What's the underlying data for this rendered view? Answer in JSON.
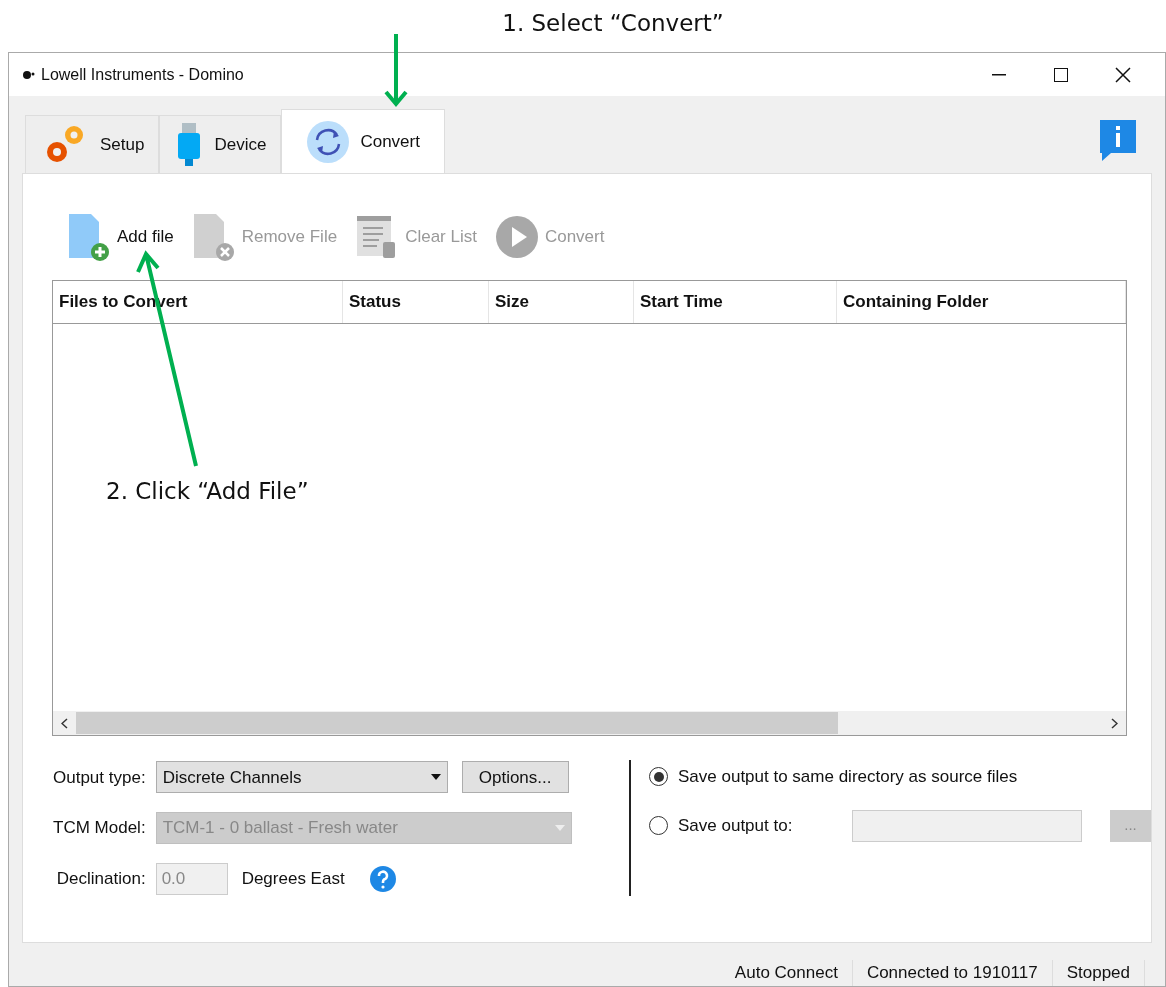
{
  "annotations": [
    {
      "text": "1. Select “Convert”"
    },
    {
      "text": "2. Click “Add File”"
    }
  ],
  "window": {
    "title": "Lowell Instruments - Domino"
  },
  "tabs": [
    {
      "label": "Setup",
      "selected": false
    },
    {
      "label": "Device",
      "selected": false
    },
    {
      "label": "Convert",
      "selected": true
    }
  ],
  "toolbar": [
    {
      "label": "Add file",
      "disabled": false
    },
    {
      "label": "Remove File",
      "disabled": true
    },
    {
      "label": "Clear List",
      "disabled": true
    },
    {
      "label": "Convert",
      "disabled": true
    }
  ],
  "table": {
    "columns": [
      "Files to Convert",
      "Status",
      "Size",
      "Start Time",
      "Containing Folder"
    ]
  },
  "output_type": {
    "label": "Output type:",
    "value": "Discrete Channels",
    "button": "Options..."
  },
  "tcm_model": {
    "label": "TCM Model:",
    "value": "TCM-1 - 0 ballast - Fresh water",
    "disabled": true
  },
  "declination": {
    "label": "Declination:",
    "value": "0.0",
    "unit": "Degrees East",
    "disabled": true
  },
  "save_options": [
    {
      "label": "Save output to same directory as source files",
      "selected": true
    },
    {
      "label": "Save output to:",
      "selected": false
    }
  ],
  "browse_button": "...",
  "status_bar": [
    "Auto Connect",
    "Connected to 1910117",
    "Stopped"
  ]
}
